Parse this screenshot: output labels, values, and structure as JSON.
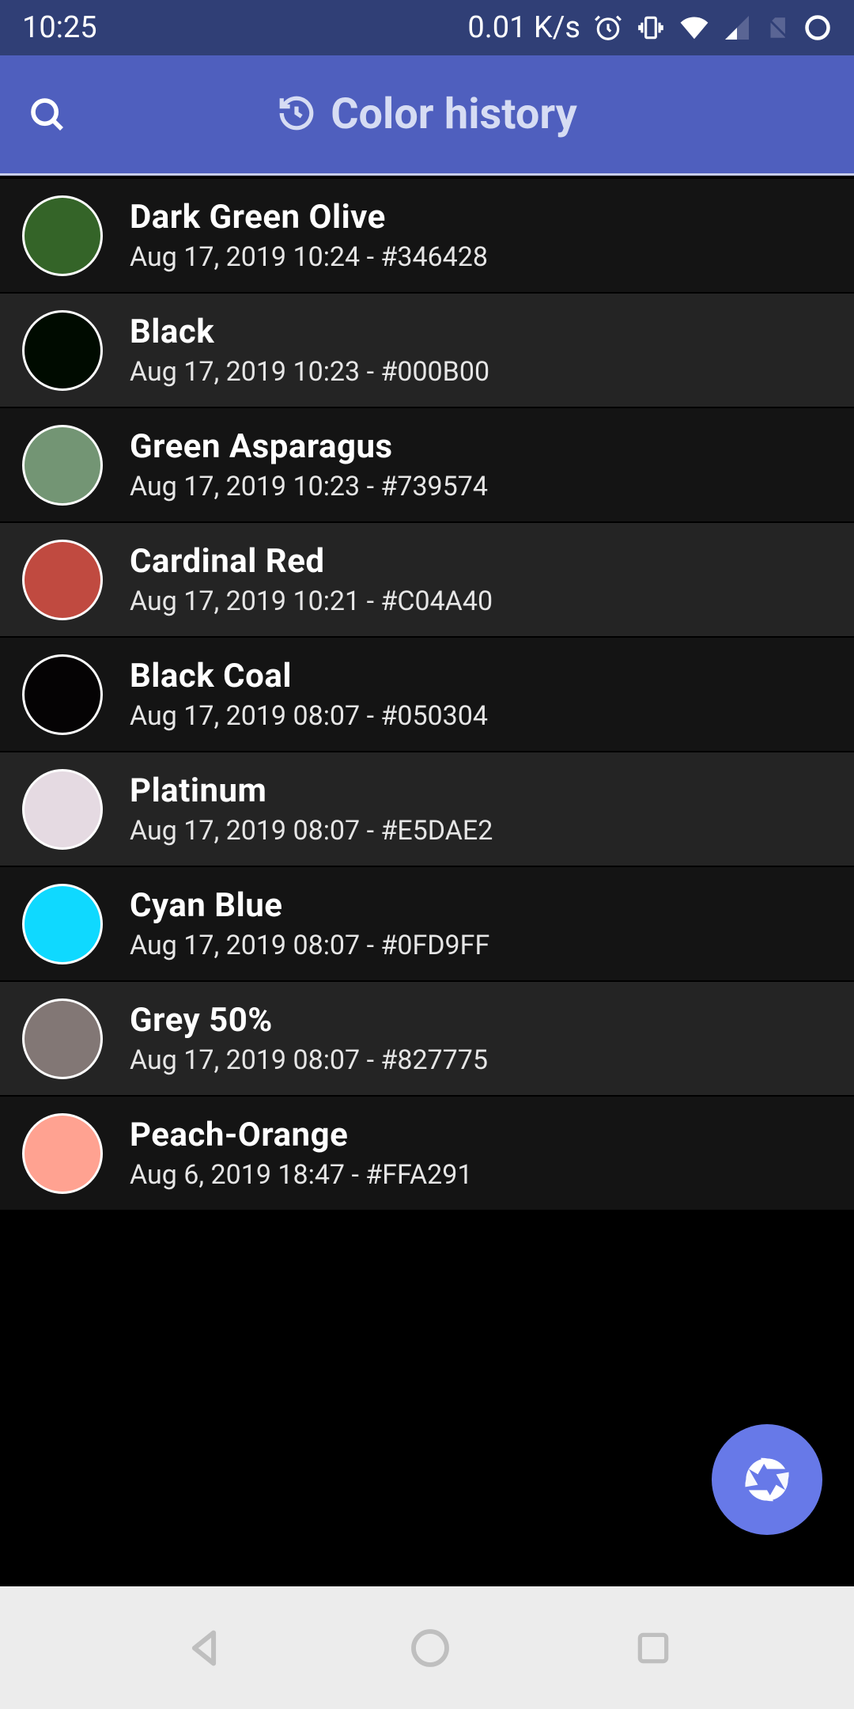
{
  "status": {
    "time": "10:25",
    "net_speed": "0.01 K/s"
  },
  "header": {
    "title": "Color history"
  },
  "items": [
    {
      "name": "Dark Green Olive",
      "sub": "Aug 17, 2019 10:24 - #346428",
      "hex": "#346428"
    },
    {
      "name": "Black",
      "sub": "Aug 17, 2019 10:23 - #000B00",
      "hex": "#000B00"
    },
    {
      "name": "Green Asparagus",
      "sub": "Aug 17, 2019 10:23 - #739574",
      "hex": "#739574"
    },
    {
      "name": "Cardinal Red",
      "sub": "Aug 17, 2019 10:21 - #C04A40",
      "hex": "#C04A40"
    },
    {
      "name": "Black Coal",
      "sub": "Aug 17, 2019 08:07 - #050304",
      "hex": "#050304"
    },
    {
      "name": "Platinum",
      "sub": "Aug 17, 2019 08:07 - #E5DAE2",
      "hex": "#E5DAE2"
    },
    {
      "name": "Cyan Blue",
      "sub": "Aug 17, 2019 08:07 - #0FD9FF",
      "hex": "#0FD9FF"
    },
    {
      "name": "Grey 50%",
      "sub": "Aug 17, 2019 08:07 - #827775",
      "hex": "#827775"
    },
    {
      "name": "Peach-Orange",
      "sub": "Aug 6, 2019 18:47 - #FFA291",
      "hex": "#FFA291"
    }
  ]
}
